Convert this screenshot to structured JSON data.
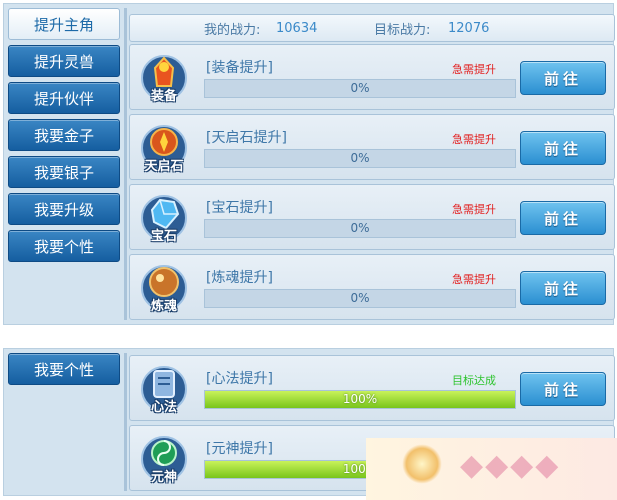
{
  "sidebar_top": [
    {
      "label": "提升主角",
      "active": true
    },
    {
      "label": "提升灵兽",
      "active": false
    },
    {
      "label": "提升伙伴",
      "active": false
    },
    {
      "label": "我要金子",
      "active": false
    },
    {
      "label": "我要银子",
      "active": false
    },
    {
      "label": "我要升级",
      "active": false
    },
    {
      "label": "我要个性",
      "active": false
    }
  ],
  "sidebar_bottom": [
    {
      "label": "我要个性",
      "active": false
    }
  ],
  "power": {
    "my_label": "我的战力:",
    "my_value": "10634",
    "target_label": "目标战力:",
    "target_value": "12076"
  },
  "rows_top": [
    {
      "icon": "equipment-icon",
      "icon_label": "装备",
      "title": "[装备提升]",
      "status": "急需提升",
      "progress": 0,
      "progress_text": "0%",
      "button": "前往"
    },
    {
      "icon": "tianqi-stone-icon",
      "icon_label": "天启石",
      "title": "[天启石提升]",
      "status": "急需提升",
      "progress": 0,
      "progress_text": "0%",
      "button": "前往"
    },
    {
      "icon": "gem-icon",
      "icon_label": "宝石",
      "title": "[宝石提升]",
      "status": "急需提升",
      "progress": 0,
      "progress_text": "0%",
      "button": "前往"
    },
    {
      "icon": "soul-refine-icon",
      "icon_label": "炼魂",
      "title": "[炼魂提升]",
      "status": "急需提升",
      "progress": 0,
      "progress_text": "0%",
      "button": "前往"
    }
  ],
  "rows_bottom": [
    {
      "icon": "mind-method-icon",
      "icon_label": "心法",
      "title": "[心法提升]",
      "status": "目标达成",
      "progress": 100,
      "progress_text": "100%",
      "button": "前往"
    },
    {
      "icon": "primal-spirit-icon",
      "icon_label": "元神",
      "title": "[元神提升]",
      "status": "",
      "progress": 100,
      "progress_text": "100%",
      "button": ""
    }
  ],
  "colors": {
    "urgent": "#e21c1c",
    "achieved": "#2fc42f",
    "accent": "#2b8fd1"
  }
}
